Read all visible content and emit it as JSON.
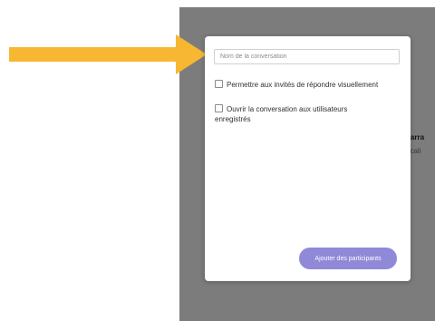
{
  "background": {
    "peek_line1": "narra",
    "peek_line2": "ecali"
  },
  "dialog": {
    "name_placeholder": "Nom de la conversation",
    "options": [
      {
        "label": "Permettre aux invités de répondre visuellement",
        "checked": false
      },
      {
        "label": "Ouvrir la conversation aux utilisateurs enregistrés",
        "checked": false
      }
    ],
    "add_button_label": "Ajouter des participants"
  },
  "colors": {
    "arrow": "#f7b733",
    "overlay": "#7c7c7c",
    "accent": "#8f89d8"
  },
  "icons": {
    "pointer": "arrow-right-icon"
  }
}
